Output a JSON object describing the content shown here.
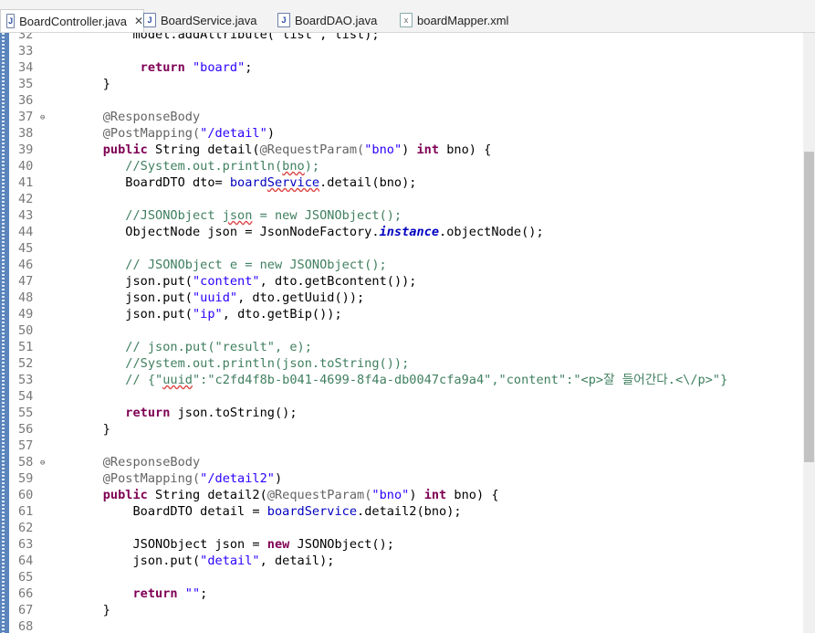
{
  "tabs": [
    {
      "label": "BoardController.java",
      "type": "java",
      "active": true,
      "closable": true
    },
    {
      "label": "BoardService.java",
      "type": "java",
      "active": false
    },
    {
      "label": "BoardDAO.java",
      "type": "java",
      "active": false
    },
    {
      "label": "boardMapper.xml",
      "type": "xml",
      "active": false
    }
  ],
  "tab_close_symbol": "✕",
  "code_lines": [
    {
      "n": "32",
      "fold": false,
      "segs": [
        {
          "t": "        model.addAttribute(\"list\", list);",
          "c": "plain"
        }
      ]
    },
    {
      "n": "33",
      "fold": false,
      "segs": []
    },
    {
      "n": "34",
      "fold": false,
      "segs": [
        {
          "t": "         ",
          "c": "plain"
        },
        {
          "t": "return",
          "c": "kw"
        },
        {
          "t": " ",
          "c": "plain"
        },
        {
          "t": "\"board\"",
          "c": "str"
        },
        {
          "t": ";",
          "c": "plain"
        }
      ]
    },
    {
      "n": "35",
      "fold": false,
      "segs": [
        {
          "t": "    }",
          "c": "plain"
        }
      ]
    },
    {
      "n": "36",
      "fold": false,
      "segs": []
    },
    {
      "n": "37",
      "fold": true,
      "segs": [
        {
          "t": "    @ResponseBody",
          "c": "an"
        }
      ]
    },
    {
      "n": "38",
      "fold": false,
      "segs": [
        {
          "t": "    @PostMapping(",
          "c": "an"
        },
        {
          "t": "\"/detail\"",
          "c": "str"
        },
        {
          "t": ")",
          "c": "plain"
        }
      ]
    },
    {
      "n": "39",
      "fold": false,
      "segs": [
        {
          "t": "    ",
          "c": "plain"
        },
        {
          "t": "public",
          "c": "kw"
        },
        {
          "t": " String detail(",
          "c": "plain"
        },
        {
          "t": "@RequestParam(",
          "c": "an"
        },
        {
          "t": "\"bno\"",
          "c": "str"
        },
        {
          "t": ") ",
          "c": "plain"
        },
        {
          "t": "int",
          "c": "kw"
        },
        {
          "t": " bno) {",
          "c": "plain"
        }
      ]
    },
    {
      "n": "40",
      "fold": false,
      "segs": [
        {
          "t": "       //System.out.println(",
          "c": "cm"
        },
        {
          "t": "bno",
          "c": "cm sq"
        },
        {
          "t": ");",
          "c": "cm"
        }
      ]
    },
    {
      "n": "41",
      "fold": false,
      "segs": [
        {
          "t": "       BoardDTO dto= ",
          "c": "plain"
        },
        {
          "t": "board",
          "c": "fld"
        },
        {
          "t": "Service",
          "c": "fld sq"
        },
        {
          "t": ".detail(bno);",
          "c": "plain"
        }
      ]
    },
    {
      "n": "42",
      "fold": false,
      "segs": []
    },
    {
      "n": "43",
      "fold": false,
      "segs": [
        {
          "t": "       //JSONObject ",
          "c": "cm"
        },
        {
          "t": "json",
          "c": "cm sq"
        },
        {
          "t": " = new JSONObject();",
          "c": "cm"
        }
      ]
    },
    {
      "n": "44",
      "fold": false,
      "segs": [
        {
          "t": "       ObjectNode json = JsonNodeFactory.",
          "c": "plain"
        },
        {
          "t": "instance",
          "c": "ital"
        },
        {
          "t": ".objectNode();",
          "c": "plain"
        }
      ]
    },
    {
      "n": "45",
      "fold": false,
      "segs": []
    },
    {
      "n": "46",
      "fold": false,
      "segs": [
        {
          "t": "       // JSONObject e = new JSONObject();",
          "c": "cm"
        }
      ]
    },
    {
      "n": "47",
      "fold": false,
      "segs": [
        {
          "t": "       json.put(",
          "c": "plain"
        },
        {
          "t": "\"content\"",
          "c": "str"
        },
        {
          "t": ", dto.getBcontent());",
          "c": "plain"
        }
      ]
    },
    {
      "n": "48",
      "fold": false,
      "segs": [
        {
          "t": "       json.put(",
          "c": "plain"
        },
        {
          "t": "\"uuid\"",
          "c": "str"
        },
        {
          "t": ", dto.getUuid());",
          "c": "plain"
        }
      ]
    },
    {
      "n": "49",
      "fold": false,
      "segs": [
        {
          "t": "       json.put(",
          "c": "plain"
        },
        {
          "t": "\"ip\"",
          "c": "str"
        },
        {
          "t": ", dto.getBip());",
          "c": "plain"
        }
      ]
    },
    {
      "n": "50",
      "fold": false,
      "segs": []
    },
    {
      "n": "51",
      "fold": false,
      "segs": [
        {
          "t": "       // json.put(\"result\", e);",
          "c": "cm"
        }
      ]
    },
    {
      "n": "52",
      "fold": false,
      "segs": [
        {
          "t": "       //System.out.println(json.toString());",
          "c": "cm"
        }
      ]
    },
    {
      "n": "53",
      "fold": false,
      "segs": [
        {
          "t": "       // {\"",
          "c": "cm"
        },
        {
          "t": "uuid",
          "c": "cm sq"
        },
        {
          "t": "\":\"c2fd4f8b-b041-4699-8f4a-db0047cfa9a4\",\"content\":\"<p>잘 들어간다.<\\/p>\"}",
          "c": "cm"
        }
      ]
    },
    {
      "n": "54",
      "fold": false,
      "segs": []
    },
    {
      "n": "55",
      "fold": false,
      "segs": [
        {
          "t": "       ",
          "c": "plain"
        },
        {
          "t": "return",
          "c": "kw"
        },
        {
          "t": " json.toString();",
          "c": "plain"
        }
      ]
    },
    {
      "n": "56",
      "fold": false,
      "segs": [
        {
          "t": "    }",
          "c": "plain"
        }
      ]
    },
    {
      "n": "57",
      "fold": false,
      "segs": []
    },
    {
      "n": "58",
      "fold": true,
      "segs": [
        {
          "t": "    @ResponseBody",
          "c": "an"
        }
      ]
    },
    {
      "n": "59",
      "fold": false,
      "segs": [
        {
          "t": "    @PostMapping(",
          "c": "an"
        },
        {
          "t": "\"/detail2\"",
          "c": "str"
        },
        {
          "t": ")",
          "c": "plain"
        }
      ]
    },
    {
      "n": "60",
      "fold": false,
      "segs": [
        {
          "t": "    ",
          "c": "plain"
        },
        {
          "t": "public",
          "c": "kw"
        },
        {
          "t": " String detail2(",
          "c": "plain"
        },
        {
          "t": "@RequestParam(",
          "c": "an"
        },
        {
          "t": "\"bno\"",
          "c": "str"
        },
        {
          "t": ") ",
          "c": "plain"
        },
        {
          "t": "int",
          "c": "kw"
        },
        {
          "t": " bno) {",
          "c": "plain"
        }
      ]
    },
    {
      "n": "61",
      "fold": false,
      "segs": [
        {
          "t": "        BoardDTO detail = ",
          "c": "plain"
        },
        {
          "t": "boardService",
          "c": "fld"
        },
        {
          "t": ".detail2(bno);",
          "c": "plain"
        }
      ]
    },
    {
      "n": "62",
      "fold": false,
      "segs": []
    },
    {
      "n": "63",
      "fold": false,
      "segs": [
        {
          "t": "        JSONObject json = ",
          "c": "plain"
        },
        {
          "t": "new",
          "c": "kw"
        },
        {
          "t": " JSONObject();",
          "c": "plain"
        }
      ]
    },
    {
      "n": "64",
      "fold": false,
      "segs": [
        {
          "t": "        json.put(",
          "c": "plain"
        },
        {
          "t": "\"detail\"",
          "c": "str"
        },
        {
          "t": ", detail);",
          "c": "plain"
        }
      ]
    },
    {
      "n": "65",
      "fold": false,
      "segs": []
    },
    {
      "n": "66",
      "fold": false,
      "segs": [
        {
          "t": "        ",
          "c": "plain"
        },
        {
          "t": "return",
          "c": "kw"
        },
        {
          "t": " ",
          "c": "plain"
        },
        {
          "t": "\"\"",
          "c": "str"
        },
        {
          "t": ";",
          "c": "plain"
        }
      ]
    },
    {
      "n": "67",
      "fold": false,
      "segs": [
        {
          "t": "    }",
          "c": "plain"
        }
      ]
    },
    {
      "n": "68",
      "fold": false,
      "segs": []
    }
  ],
  "colors": {
    "keyword": "#7f0055",
    "string": "#2a00ff",
    "comment": "#3f7f5f",
    "annotation": "#646464",
    "field": "#0000c0"
  }
}
